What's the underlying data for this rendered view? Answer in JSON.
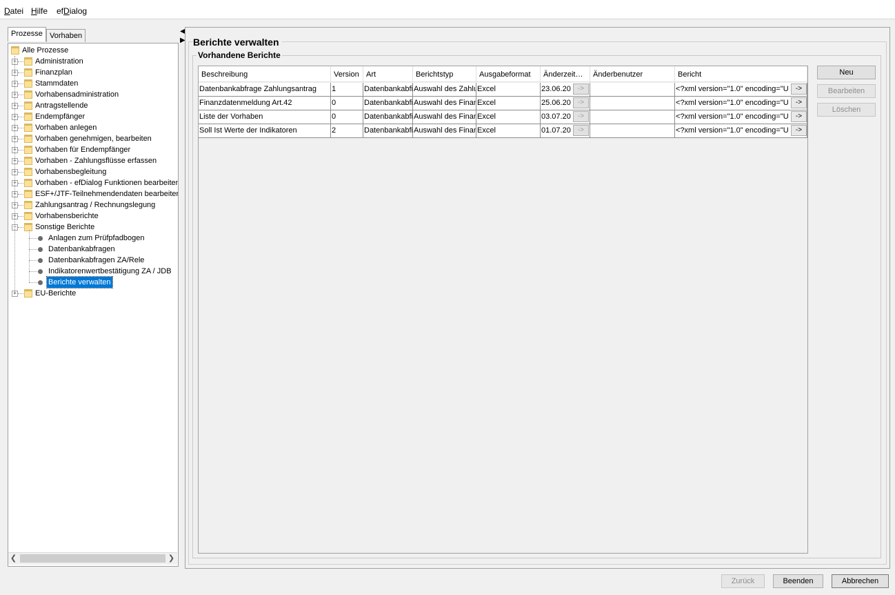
{
  "menu": {
    "items": [
      {
        "label": "Datei",
        "mnemonic": "D",
        "rest": "atei"
      },
      {
        "label": "Hilfe",
        "mnemonic": "H",
        "rest": "ilfe"
      },
      {
        "label": "efDialog",
        "prefix": "ef",
        "mnemonic": "D",
        "rest": "ialog"
      }
    ]
  },
  "left_tabs": [
    {
      "label": "Prozesse",
      "active": true
    },
    {
      "label": "Vorhaben",
      "active": false
    }
  ],
  "tree": {
    "root": "Alle Prozesse",
    "items": [
      {
        "label": "Administration",
        "expanded": false
      },
      {
        "label": "Finanzplan",
        "expanded": false
      },
      {
        "label": "Stammdaten",
        "expanded": false
      },
      {
        "label": "Vorhabensadministration",
        "expanded": false
      },
      {
        "label": "Antragstellende",
        "expanded": false
      },
      {
        "label": "Endempfänger",
        "expanded": false
      },
      {
        "label": "Vorhaben anlegen",
        "expanded": false
      },
      {
        "label": "Vorhaben genehmigen, bearbeiten",
        "expanded": false
      },
      {
        "label": "Vorhaben für Endempfänger",
        "expanded": false
      },
      {
        "label": "Vorhaben - Zahlungsflüsse erfassen",
        "expanded": false
      },
      {
        "label": "Vorhabensbegleitung",
        "expanded": false
      },
      {
        "label": "Vorhaben - efDialog Funktionen bearbeiten",
        "expanded": false
      },
      {
        "label": "ESF+/JTF-Teilnehmendendaten bearbeiten",
        "expanded": false
      },
      {
        "label": "Zahlungsantrag / Rechnungslegung",
        "expanded": false
      },
      {
        "label": "Vorhabensberichte",
        "expanded": false
      },
      {
        "label": "Sonstige Berichte",
        "expanded": true
      }
    ],
    "children": [
      {
        "label": "Anlagen zum Prüfpfadbogen"
      },
      {
        "label": "Datenbankabfragen"
      },
      {
        "label": "Datenbankabfragen ZA/Rele"
      },
      {
        "label": "Indikatorenwertbestätigung ZA / JDB"
      },
      {
        "label": "Berichte verwalten",
        "selected": true
      }
    ],
    "last": {
      "label": "EU-Berichte",
      "expanded": false
    }
  },
  "main": {
    "title": "Berichte verwalten",
    "group_title": "Vorhandene Berichte",
    "columns": [
      "Beschreibung",
      "Version",
      "Art",
      "Berichtstyp",
      "Ausgabeformat",
      "Änderzeit…",
      "Änderbenutzer",
      "Bericht"
    ],
    "rows": [
      {
        "beschreibung": "Datenbankabfrage Zahlungsantrag",
        "version": "1",
        "art": "Datenbankabfi",
        "berichtstyp": "Auswahl des Zahlu",
        "ausgabeformat": "Excel",
        "aenderzeit": "23.06.20",
        "aenderbenutzer": "",
        "bericht": "<?xml version=\"1.0\" encoding=\"U"
      },
      {
        "beschreibung": "Finanzdatenmeldung Art.42",
        "version": "0",
        "art": "Datenbankabfi",
        "berichtstyp": "Auswahl des Finan",
        "ausgabeformat": "Excel",
        "aenderzeit": "25.06.20",
        "aenderbenutzer": "",
        "bericht": "<?xml version=\"1.0\" encoding=\"U"
      },
      {
        "beschreibung": "Liste der Vorhaben",
        "version": "0",
        "art": "Datenbankabfi",
        "berichtstyp": "Auswahl des Finan",
        "ausgabeformat": "Excel",
        "aenderzeit": "03.07.20",
        "aenderbenutzer": "",
        "bericht": "<?xml version=\"1.0\" encoding=\"U"
      },
      {
        "beschreibung": "Soll Ist Werte der Indikatoren",
        "version": "2",
        "art": "Datenbankabfi",
        "berichtstyp": "Auswahl des Finan",
        "ausgabeformat": "Excel",
        "aenderzeit": "01.07.20",
        "aenderbenutzer": "",
        "bericht": "<?xml version=\"1.0\" encoding=\"U"
      }
    ],
    "cell_button_label": "->",
    "side_buttons": [
      {
        "label": "Neu",
        "enabled": true
      },
      {
        "label": "Bearbeiten",
        "enabled": false
      },
      {
        "label": "Löschen",
        "enabled": false
      }
    ]
  },
  "footer": {
    "back": {
      "label": "Zurück",
      "enabled": false
    },
    "finish": {
      "label": "Beenden",
      "enabled": true
    },
    "cancel": {
      "label": "Abbrechen",
      "enabled": true
    }
  }
}
